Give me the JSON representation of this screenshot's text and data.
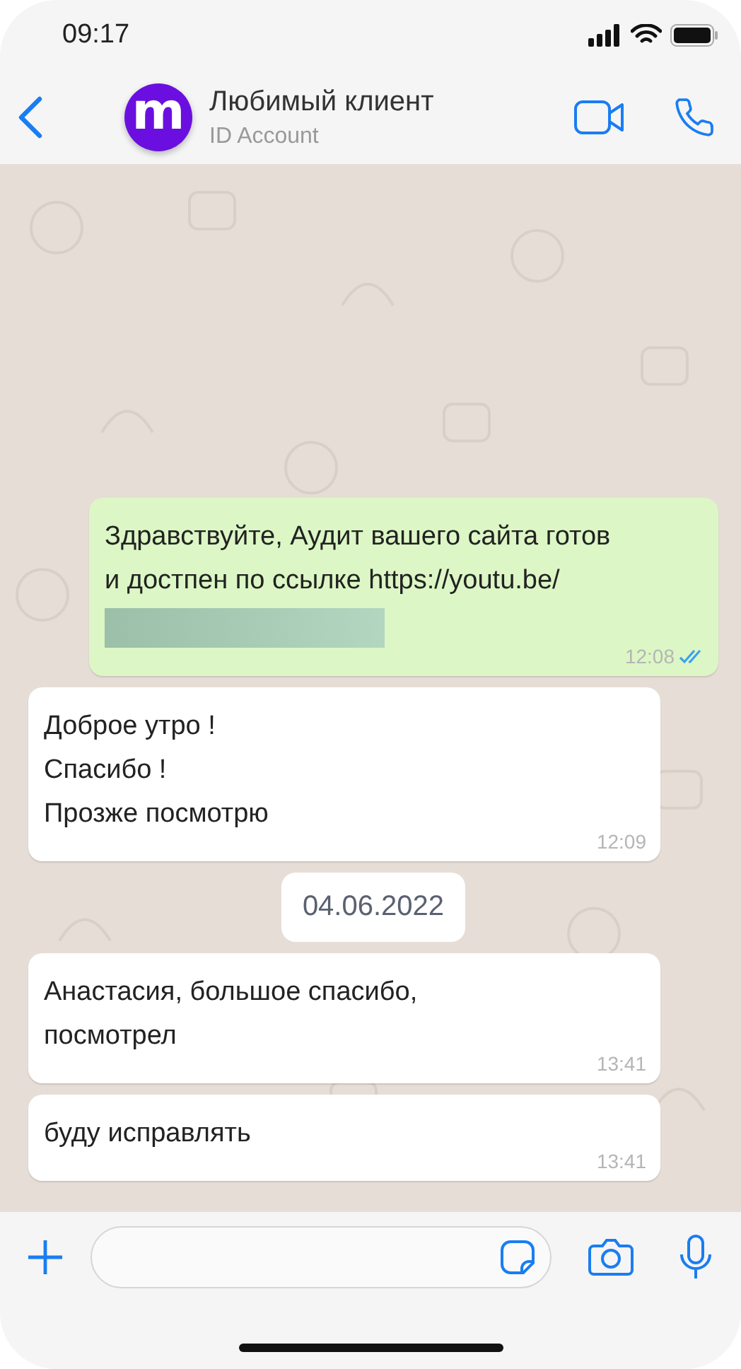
{
  "status_bar": {
    "time": "09:17"
  },
  "header": {
    "avatar_letter": "m",
    "name": "Любимый клиент",
    "subtitle": "ID Account"
  },
  "chat": [
    {
      "kind": "outgoing",
      "lines": [
        "Здравствуйте, Аудит вашего сайта готов",
        "и достпен по ссылке https://youtu.be/"
      ],
      "redacted": true,
      "time": "12:08",
      "read": true
    },
    {
      "kind": "incoming",
      "lines": [
        "Доброе утро !",
        "Спасибо !",
        "Прозже посмотрю"
      ],
      "redacted": false,
      "time": "12:09"
    },
    {
      "kind": "date",
      "label": "04.06.2022"
    },
    {
      "kind": "incoming",
      "lines": [
        "Анастасия, большое спасибо,",
        "посмотрел"
      ],
      "redacted": false,
      "time": "13:41"
    },
    {
      "kind": "incoming",
      "lines": [
        "буду исправлять"
      ],
      "redacted": false,
      "time": "13:41"
    }
  ]
}
